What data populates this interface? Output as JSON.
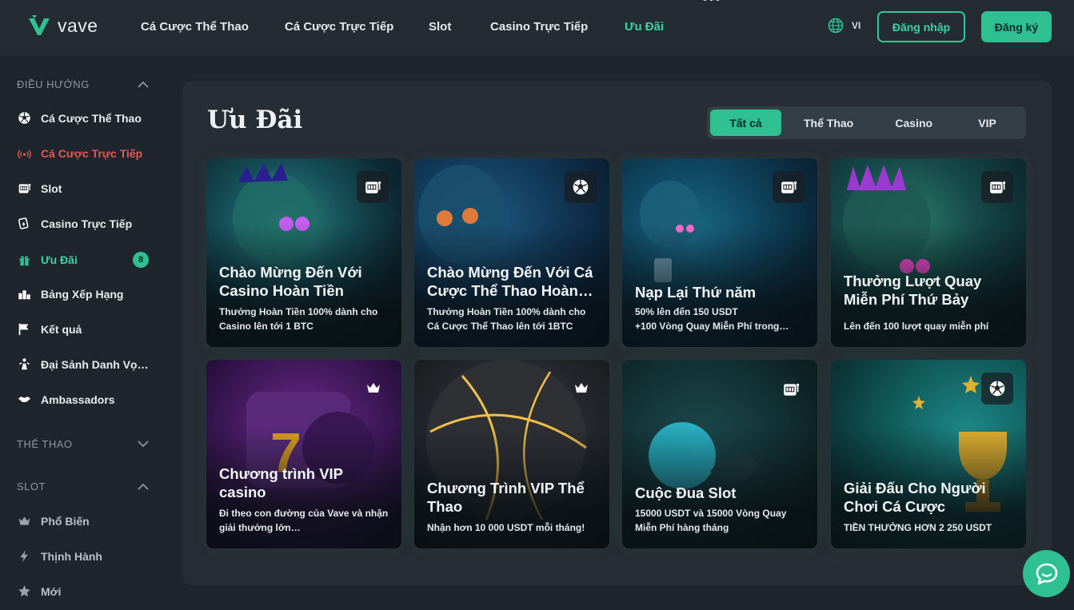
{
  "header": {
    "logo_text": "vave",
    "nav": [
      {
        "label": "Cá Cược Thể Thao"
      },
      {
        "label": "Cá Cược Trực Tiếp"
      },
      {
        "label": "Slot"
      },
      {
        "label": "Casino Trực Tiếp"
      },
      {
        "label": "Ưu Đãi",
        "active": true
      }
    ],
    "more_label": "•••",
    "language": "VI",
    "login_label": "Đăng nhập",
    "register_label": "Đăng ký"
  },
  "sidebar": {
    "nav_section": {
      "title": "ĐIỀU HƯỚNG",
      "expanded": true
    },
    "nav_items": [
      {
        "label": "Cá Cược Thể Thao",
        "icon": "soccer-ball-icon"
      },
      {
        "label": "Cá Cược Trực Tiếp",
        "icon": "live-broadcast-icon"
      },
      {
        "label": "Slot",
        "icon": "slot-machine-icon"
      },
      {
        "label": "Casino Trực Tiếp",
        "icon": "poker-chip-icon"
      },
      {
        "label": "Ưu Đãi",
        "icon": "gift-icon",
        "badge": "8"
      },
      {
        "label": "Bảng Xếp Hạng",
        "icon": "leaderboard-icon"
      },
      {
        "label": "Kết quả",
        "icon": "flag-icon"
      },
      {
        "label": "Đại Sảnh Danh Vọng",
        "icon": "hall-of-fame-icon"
      },
      {
        "label": "Ambassadors",
        "icon": "handshake-icon"
      }
    ],
    "sport_section": {
      "title": "THỂ THAO",
      "expanded": false
    },
    "slot_section": {
      "title": "SLOT",
      "expanded": true
    },
    "slot_items": [
      {
        "label": "Phổ Biến",
        "icon": "crown-icon"
      },
      {
        "label": "Thịnh Hành",
        "icon": "lightning-icon"
      },
      {
        "label": "Mới",
        "icon": "star-icon"
      }
    ]
  },
  "main": {
    "title": "Ưu Đãi",
    "filters": [
      {
        "label": "Tất cả",
        "active": true
      },
      {
        "label": "Thể Thao"
      },
      {
        "label": "Casino"
      },
      {
        "label": "VIP"
      }
    ],
    "cards": [
      {
        "title": "Chào Mừng Đến Với Casino Hoàn Tiền",
        "desc": "Thưởng Hoàn Tiền 100% dành cho Casino lên tới 1 BTC",
        "icon": "slot-machine-icon"
      },
      {
        "title": "Chào Mừng Đến Với Cá Cược Thể Thao Hoàn…",
        "desc": "Thưởng Hoàn Tiền 100% dành cho Cá Cược Thể Thao lên tới 1BTC",
        "icon": "soccer-ball-icon"
      },
      {
        "title": "Nạp Lại Thứ năm",
        "desc_lines": [
          "50% lên đến 150 USDT",
          "+100 Vòng Quay Miễn Phí trong…"
        ],
        "icon": "slot-machine-icon"
      },
      {
        "title": "Thưởng Lượt Quay Miễn Phí Thứ Bảy",
        "desc": "Lên đến 100 lượt quay miễn phí",
        "icon": "slot-machine-icon"
      },
      {
        "title": "Chương trình VIP casino",
        "desc": "Đi theo con đường của Vave và nhận giải thưởng lớn…",
        "icon": "crown-icon"
      },
      {
        "title": "Chương Trình VIP Thể Thao",
        "desc": "Nhận hơn 10 000 USDT mỗi tháng!",
        "icon": "crown-icon"
      },
      {
        "title": "Cuộc Đua Slot",
        "desc": "15000 USDT và 15000 Vòng Quay Miễn Phí hàng tháng",
        "icon": "slot-machine-icon"
      },
      {
        "title": "Giải Đấu Cho Người Chơi Cá Cược",
        "desc": "TIỀN THƯỞNG HƠN 2 250 USDT",
        "icon": "soccer-ball-icon"
      }
    ]
  },
  "colors": {
    "accent": "#2fc092",
    "accent_text": "#3ed1a6",
    "live": "#e85555",
    "bg": "#1f252c",
    "panel": "#262d34"
  }
}
